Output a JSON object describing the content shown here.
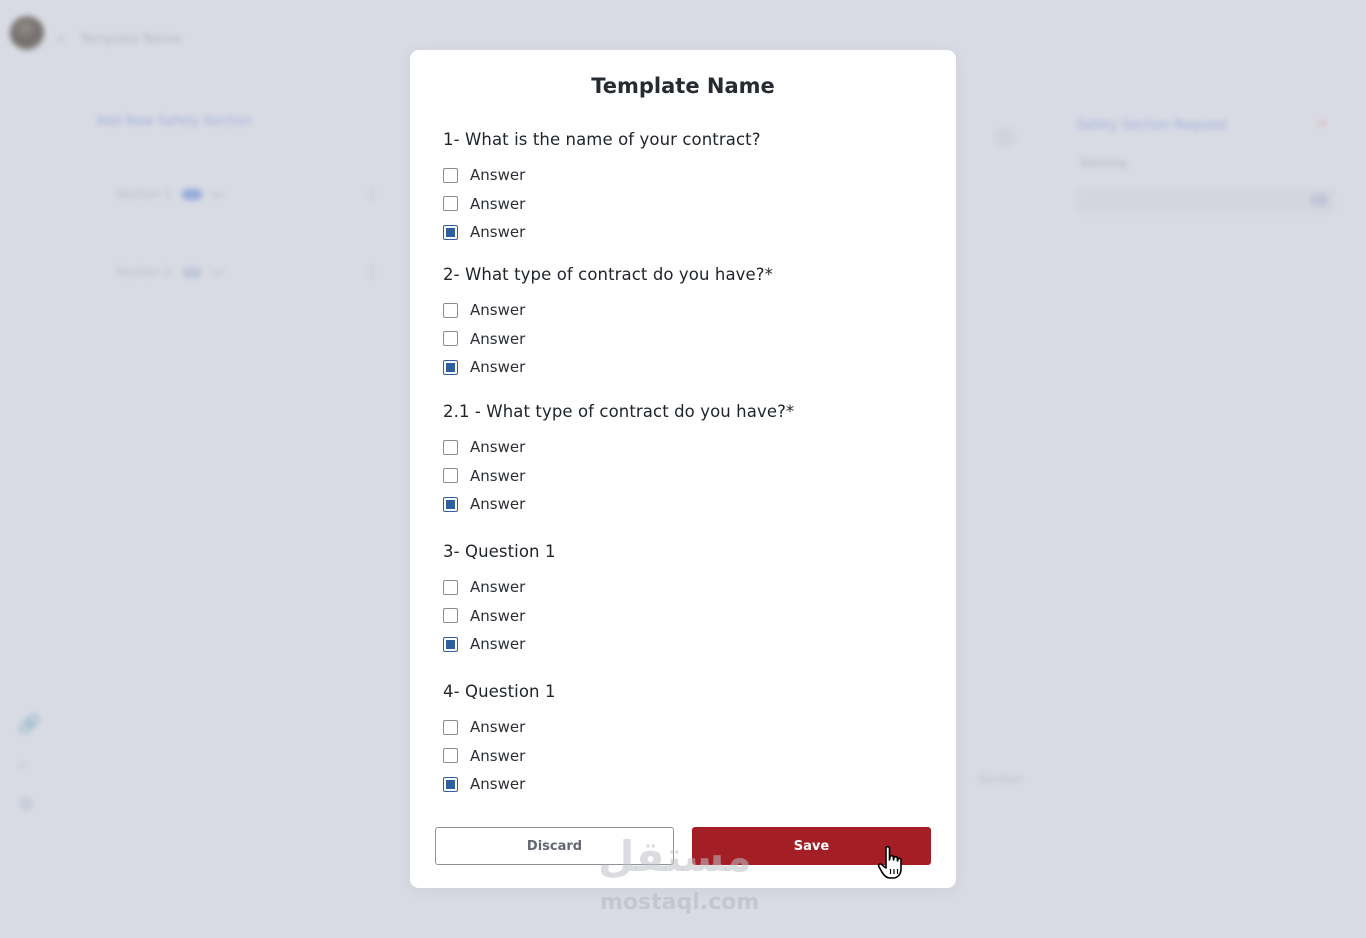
{
  "background": {
    "app_title": "Template Name",
    "add_section_link": "Add New Safety Section",
    "sections": [
      {
        "label": "Section 1"
      },
      {
        "label": "Section 2"
      }
    ],
    "right_panel": {
      "link": "Safety Section Request",
      "label": "Naming",
      "input_value": "1 min"
    },
    "footer_text": "Section"
  },
  "modal": {
    "title": "Template Name",
    "questions": [
      {
        "label": "1- What is the name of your contract?",
        "options": [
          {
            "label": "Answer",
            "checked": false
          },
          {
            "label": "Answer",
            "checked": false
          },
          {
            "label": "Answer",
            "checked": true
          }
        ]
      },
      {
        "label": "2- What type of contract do you have?*",
        "options": [
          {
            "label": "Answer",
            "checked": false
          },
          {
            "label": "Answer",
            "checked": false
          },
          {
            "label": "Answer",
            "checked": true
          }
        ]
      },
      {
        "label": "2.1 - What type of contract do you have?*",
        "options": [
          {
            "label": "Answer",
            "checked": false
          },
          {
            "label": "Answer",
            "checked": false
          },
          {
            "label": "Answer",
            "checked": true
          }
        ]
      },
      {
        "label": "3- Question 1",
        "options": [
          {
            "label": "Answer",
            "checked": false
          },
          {
            "label": "Answer",
            "checked": false
          },
          {
            "label": "Answer",
            "checked": true
          }
        ]
      },
      {
        "label": "4- Question 1",
        "options": [
          {
            "label": "Answer",
            "checked": false
          },
          {
            "label": "Answer",
            "checked": false
          },
          {
            "label": "Answer",
            "checked": true
          }
        ]
      }
    ],
    "discard_label": "Discard",
    "save_label": "Save"
  },
  "watermark": {
    "arabic": "مستقل",
    "latin": "mostaql.com"
  },
  "colors": {
    "accent": "#2f5f9e",
    "save": "#a31f25",
    "backdrop": "#d9dbe4"
  },
  "icons": {
    "cursor": "hand-pointer-icon",
    "side": [
      "link-icon",
      "search-icon",
      "settings-icon"
    ]
  }
}
